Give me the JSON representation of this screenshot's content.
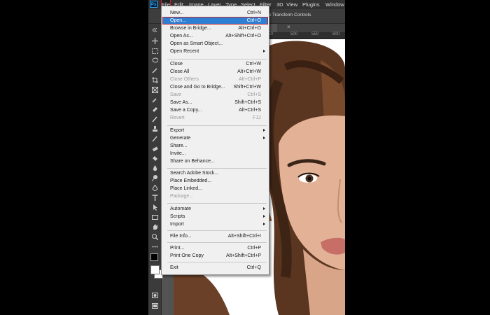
{
  "menubar": {
    "logo": "Ps",
    "items": [
      "File",
      "Edit",
      "Image",
      "Layer",
      "Type",
      "Select",
      "Filter",
      "3D",
      "View",
      "Plugins",
      "Window"
    ]
  },
  "optionsbar": {
    "show_transform_label": "Show Transform Controls"
  },
  "document": {
    "tab_close": "×",
    "ruler_ticks": [
      "450",
      "500",
      "550",
      "600"
    ]
  },
  "file_menu": {
    "items": [
      {
        "label": "New...",
        "shortcut": "Ctrl+N"
      },
      {
        "label": "Open...",
        "shortcut": "Ctrl+O",
        "highlighted": true
      },
      {
        "label": "Browse in Bridge...",
        "shortcut": "Alt+Ctrl+O"
      },
      {
        "label": "Open As...",
        "shortcut": "Alt+Shift+Ctrl+O"
      },
      {
        "label": "Open as Smart Object..."
      },
      {
        "label": "Open Recent",
        "submenu": true
      },
      {
        "label": "Close",
        "shortcut": "Ctrl+W"
      },
      {
        "label": "Close All",
        "shortcut": "Alt+Ctrl+W"
      },
      {
        "label": "Close Others",
        "shortcut": "Alt+Ctrl+P",
        "disabled": true
      },
      {
        "label": "Close and Go to Bridge...",
        "shortcut": "Shift+Ctrl+W"
      },
      {
        "label": "Save",
        "shortcut": "Ctrl+S",
        "disabled": true
      },
      {
        "label": "Save As...",
        "shortcut": "Shift+Ctrl+S"
      },
      {
        "label": "Save a Copy...",
        "shortcut": "Alt+Ctrl+S"
      },
      {
        "label": "Revert",
        "shortcut": "F12",
        "disabled": true
      },
      {
        "label": "Export",
        "submenu": true
      },
      {
        "label": "Generate",
        "submenu": true
      },
      {
        "label": "Share..."
      },
      {
        "label": "Invite..."
      },
      {
        "label": "Share on Behance..."
      },
      {
        "label": "Search Adobe Stock..."
      },
      {
        "label": "Place Embedded..."
      },
      {
        "label": "Place Linked..."
      },
      {
        "label": "Package...",
        "disabled": true
      },
      {
        "label": "Automate",
        "submenu": true
      },
      {
        "label": "Scripts",
        "submenu": true
      },
      {
        "label": "Import",
        "submenu": true
      },
      {
        "label": "File Info...",
        "shortcut": "Alt+Shift+Ctrl+I"
      },
      {
        "label": "Print...",
        "shortcut": "Ctrl+P"
      },
      {
        "label": "Print One Copy",
        "shortcut": "Alt+Shift+Ctrl+P"
      },
      {
        "label": "Exit",
        "shortcut": "Ctrl+Q"
      }
    ]
  },
  "colors": {
    "menu_highlight": "#2d7fd4",
    "annotation_red": "#c0262b",
    "photoshop_blue": "#31a8ff"
  }
}
